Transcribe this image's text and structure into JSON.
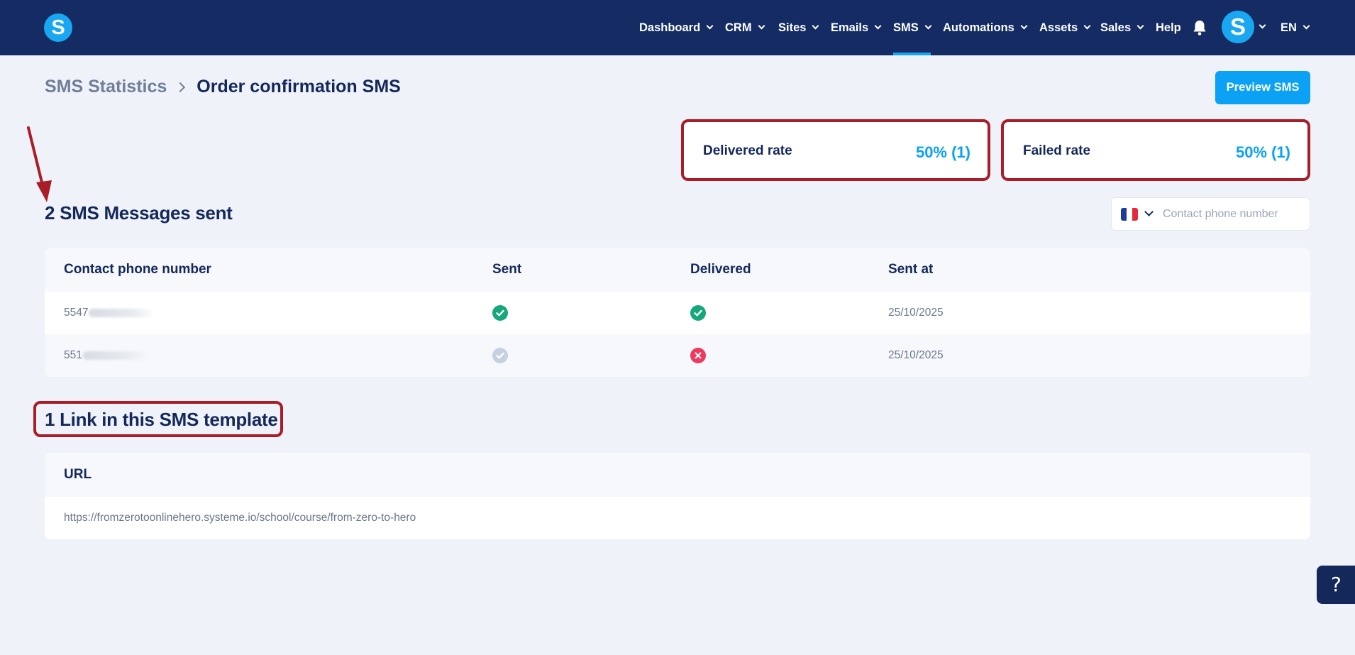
{
  "nav": {
    "logo_letter": "S",
    "items": [
      {
        "label": "Dashboard",
        "has_dropdown": true
      },
      {
        "label": "CRM",
        "has_dropdown": true
      },
      {
        "label": "Sites",
        "has_dropdown": true
      },
      {
        "label": "Emails",
        "has_dropdown": true
      },
      {
        "label": "SMS",
        "has_dropdown": true,
        "active": true
      },
      {
        "label": "Automations",
        "has_dropdown": true
      },
      {
        "label": "Assets",
        "has_dropdown": true
      },
      {
        "label": "Sales",
        "has_dropdown": true
      },
      {
        "label": "Help",
        "has_dropdown": false
      }
    ],
    "bell_icon": "bell-icon",
    "avatar_letter": "S",
    "language": "EN"
  },
  "header": {
    "breadcrumb_parent": "SMS Statistics",
    "breadcrumb_current": "Order confirmation SMS",
    "preview_button": "Preview SMS"
  },
  "stats": {
    "delivered": {
      "label": "Delivered rate",
      "value": "50% (1)"
    },
    "failed": {
      "label": "Failed rate",
      "value": "50% (1)"
    }
  },
  "messages": {
    "title": "2 SMS Messages sent",
    "search_placeholder": "Contact phone number",
    "country_flag": "France",
    "columns": [
      "Contact phone number",
      "Sent",
      "Delivered",
      "Sent at"
    ],
    "rows": [
      {
        "phone": "5547",
        "sent": "success",
        "delivered": "success",
        "sent_at": "25/10/2025"
      },
      {
        "phone": "551",
        "sent": "neutral",
        "delivered": "failed",
        "sent_at": "25/10/2025"
      }
    ]
  },
  "links": {
    "title": "1 Link in this SMS template",
    "column": "URL",
    "rows": [
      "https://fromzerotoonlinehero.systeme.io/school/course/from-zero-to-hero"
    ]
  },
  "help_button": "?",
  "colors": {
    "nav_bg": "#142c63",
    "accent": "#0ba2f5",
    "success": "#14a87a",
    "failed": "#f0395e",
    "neutral": "#c5d0e0",
    "highlight_border": "#a81d28"
  }
}
